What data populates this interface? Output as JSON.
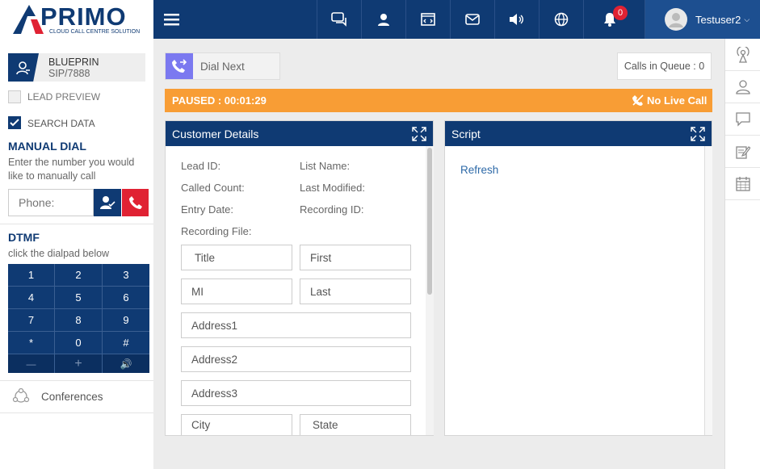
{
  "logo": {
    "brand": "PRIMO",
    "tagline": "CLOUD CALL CENTRE SOLUTION"
  },
  "topbar": {
    "notification_count": "0",
    "username": "Testuser2"
  },
  "sidebar": {
    "campaign": "BLUEPRIN",
    "extension": "SIP/7888",
    "lead_preview": "LEAD PREVIEW",
    "search_data": "SEARCH DATA",
    "manual_dial_title": "MANUAL DIAL",
    "manual_dial_desc": "Enter the number you would like to manually call",
    "phone_placeholder": "Phone:",
    "dtmf_title": "DTMF",
    "dtmf_desc": "click the dialpad below",
    "dialpad": [
      "1",
      "2",
      "3",
      "4",
      "5",
      "6",
      "7",
      "8",
      "9",
      "*",
      "0",
      "#"
    ],
    "conferences": "Conferences"
  },
  "toolbar": {
    "dial_next": "Dial Next",
    "calls_in_queue": "Calls in Queue : 0"
  },
  "status": {
    "paused": "PAUSED : 00:01:29",
    "no_live_call": "No Live Call"
  },
  "customer": {
    "title": "Customer Details",
    "lead_id": "Lead ID:",
    "list_name": "List Name:",
    "called_count": "Called Count:",
    "last_modified": "Last Modified:",
    "entry_date": "Entry Date:",
    "recording_id": "Recording ID:",
    "recording_file": "Recording File:",
    "fields": {
      "title": "Title",
      "first": "First",
      "mi": "MI",
      "last": "Last",
      "address1": "Address1",
      "address2": "Address2",
      "address3": "Address3",
      "city": "City",
      "state": "State"
    }
  },
  "script": {
    "title": "Script",
    "refresh": "Refresh"
  },
  "colors": {
    "navy": "#0f3a73",
    "orange": "#f89d35",
    "red": "#e02233",
    "purple": "#7b79f0"
  }
}
